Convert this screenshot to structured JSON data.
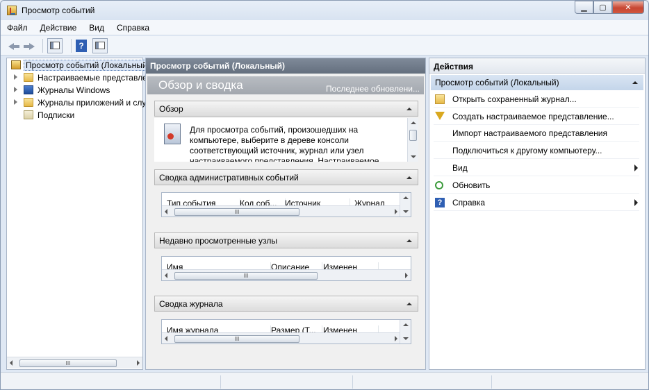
{
  "window": {
    "title": "Просмотр событий",
    "controls": {
      "minimize": "▁",
      "maximize": "▢",
      "close": "✕"
    }
  },
  "menubar": [
    "Файл",
    "Действие",
    "Вид",
    "Справка"
  ],
  "toolbar": {
    "icons": [
      "back-arrow-icon",
      "forward-arrow-icon",
      "show-pane-icon",
      "help-icon",
      "action-pane-icon"
    ],
    "help_glyph": "?"
  },
  "tree": {
    "items": [
      {
        "label": "Просмотр событий (Локальный)",
        "icon": "event-viewer-icon"
      },
      {
        "label": "Настраиваемые представления",
        "icon": "folder-icon"
      },
      {
        "label": "Журналы Windows",
        "icon": "windows-logs-icon"
      },
      {
        "label": "Журналы приложений и служб",
        "icon": "folder-icon"
      },
      {
        "label": "Подписки",
        "icon": "subscriptions-icon"
      }
    ],
    "scroll_thumb": "III"
  },
  "center": {
    "header": "Просмотр событий (Локальный)",
    "overview_title": "Обзор и сводка",
    "last_updated": "Последнее обновлени...",
    "sections": {
      "overview": {
        "title": "Обзор",
        "text": "Для просмотра событий, произошедших на компьютере, выберите в дереве консоли соответствующий источник, журнал или узел настраиваемого представления. Настраиваемое"
      },
      "admin_summary": {
        "title": "Сводка административных событий",
        "columns": [
          "Тип события",
          "Код соб...",
          "Источник",
          "Журнал"
        ]
      },
      "recent_nodes": {
        "title": "Недавно просмотренные узлы",
        "columns": [
          "Имя",
          "Описание",
          "Изменен"
        ]
      },
      "log_summary": {
        "title": "Сводка журнала",
        "columns": [
          "Имя журнала",
          "Размер (Т...",
          "Изменен"
        ]
      }
    },
    "scroll_thumb": "III"
  },
  "actions": {
    "header": "Действия",
    "group": "Просмотр событий (Локальный)",
    "items": [
      {
        "label": "Открыть сохраненный журнал...",
        "icon": "open-folder-icon",
        "submenu": false
      },
      {
        "label": "Создать настраиваемое представление...",
        "icon": "filter-icon",
        "submenu": false
      },
      {
        "label": "Импорт настраиваемого представления",
        "icon": "",
        "submenu": false
      },
      {
        "label": "Подключиться к другому компьютеру...",
        "icon": "",
        "submenu": false
      },
      {
        "label": "Вид",
        "icon": "",
        "submenu": true
      },
      {
        "label": "Обновить",
        "icon": "refresh-icon",
        "submenu": false
      },
      {
        "label": "Справка",
        "icon": "help-icon",
        "submenu": true
      }
    ],
    "help_glyph": "?"
  }
}
